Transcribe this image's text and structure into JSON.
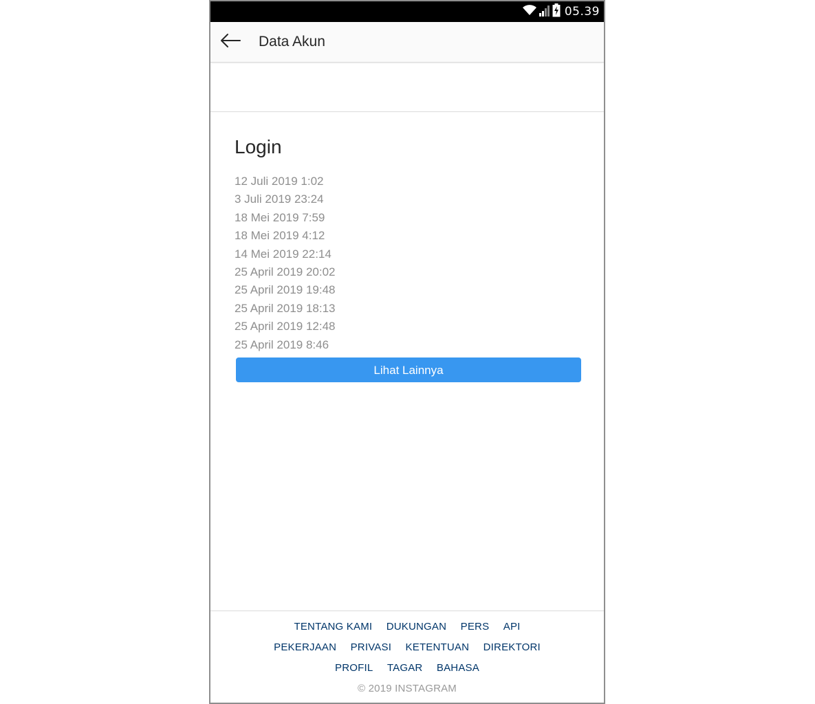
{
  "status_bar": {
    "time": "05.39",
    "icons": [
      "wifi-icon",
      "signal-icon",
      "battery-charging-icon"
    ]
  },
  "app_bar": {
    "back_icon": "arrow-left-icon",
    "title": "Data Akun"
  },
  "section": {
    "title": "Login",
    "entries": [
      "12 Juli 2019 1:02",
      "3 Juli 2019 23:24",
      "18 Mei 2019 7:59",
      "18 Mei 2019 4:12",
      "14 Mei 2019 22:14",
      "25 April 2019 20:02",
      "25 April 2019 19:48",
      "25 April 2019 18:13",
      "25 April 2019 12:48",
      "25 April 2019 8:46"
    ],
    "more_button": "Lihat Lainnya"
  },
  "footer": {
    "links": [
      "TENTANG KAMI",
      "DUKUNGAN",
      "PERS",
      "API",
      "PEKERJAAN",
      "PRIVASI",
      "KETENTUAN",
      "DIREKTORI",
      "PROFIL",
      "TAGAR",
      "BAHASA"
    ],
    "copyright": "© 2019 INSTAGRAM"
  },
  "colors": {
    "accent": "#3897f0",
    "link": "#003569",
    "muted_text": "#8e8e8e"
  }
}
